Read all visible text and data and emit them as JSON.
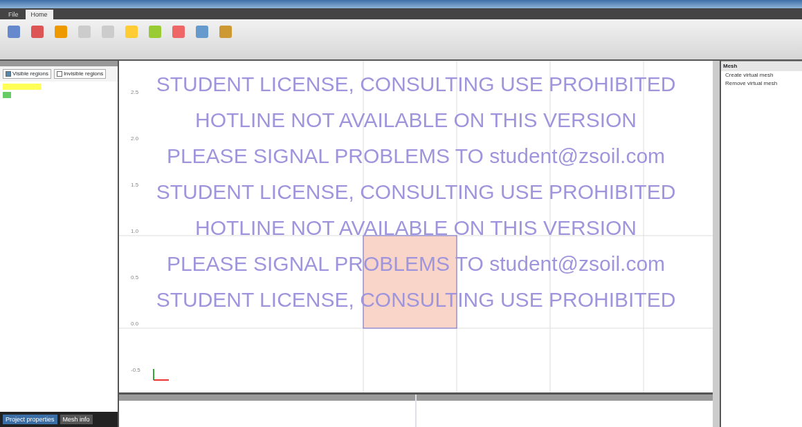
{
  "menu_tabs": [
    {
      "label": "File",
      "selected": false
    },
    {
      "label": "Home",
      "selected": true
    }
  ],
  "left_panel": {
    "filters": [
      {
        "label": "Visible regions",
        "checked": true
      },
      {
        "label": "Invisible regions",
        "checked": false
      }
    ],
    "regions": [
      {
        "selected": true
      },
      {
        "selected": false
      }
    ],
    "bottom_tabs": [
      {
        "label": "Project properties",
        "selected": true
      },
      {
        "label": "Mesh info",
        "selected": false
      }
    ]
  },
  "canvas": {
    "y_labels": [
      "2.5",
      "2.0",
      "1.5",
      "1.0",
      "0.5",
      "0.0",
      "-0.5"
    ],
    "watermarks": [
      "STUDENT LICENSE, CONSULTING USE PROHIBITED",
      "HOTLINE NOT AVAILABLE ON THIS VERSION",
      "PLEASE SIGNAL PROBLEMS TO student@zsoil.com",
      "STUDENT LICENSE, CONSULTING USE PROHIBITED",
      "HOTLINE NOT AVAILABLE ON THIS VERSION",
      "PLEASE SIGNAL PROBLEMS TO student@zsoil.com",
      "STUDENT LICENSE, CONSULTING USE PROHIBITED"
    ]
  },
  "right_panel": {
    "sections": [
      {
        "title": "Mesh",
        "items": [
          "Create virtual mesh",
          "Remove virtual mesh"
        ]
      }
    ]
  }
}
